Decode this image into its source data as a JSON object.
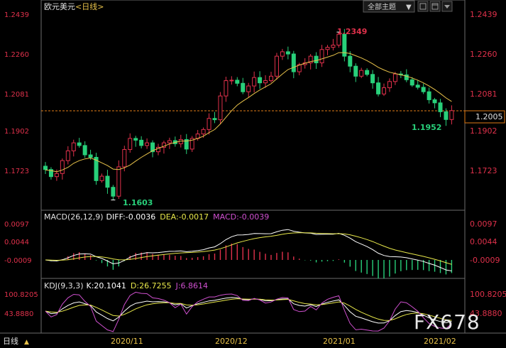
{
  "toolbar": {
    "instrument": "欧元美元",
    "period": "日线",
    "theme_label": "全部主题",
    "theme_arrow": "▼",
    "period_selector": "日线",
    "period_arrow": "▲",
    "icons": [
      "checkbox-icon",
      "window-icon",
      "scroll-down-icon"
    ]
  },
  "colors": {
    "up": "#e0314b",
    "down": "#28d07a",
    "ma": "#e8c24a",
    "diff": "#ffffff",
    "dea": "#e8e84a",
    "macd": "#d050d0",
    "k": "#ffffff",
    "d": "#e8e84a",
    "j": "#d050d0",
    "dashed": "#e07b16"
  },
  "price_axis_left": [
    "1.2439",
    "1.2260",
    "1.2081",
    "1.1902",
    "1.1723"
  ],
  "price_axis_right": [
    "1.2439",
    "1.2260",
    "1.2081",
    "1.1902",
    "1.1723"
  ],
  "current_price": "1.2005",
  "annotations": {
    "high": "1.2349",
    "low": "1.1603",
    "last_low": "1.1952"
  },
  "macd": {
    "label": "MACD(26,12,9)",
    "diff": "DIFF:-0.0036",
    "dea": "DEA:-0.0017",
    "macd": "MACD:-0.0039",
    "axis": [
      "0.0097",
      "0.0044",
      "-0.0009"
    ]
  },
  "kdj": {
    "label": "KDJ(9,3,3)",
    "k": "K:20.1041",
    "d": "D:26.7255",
    "j": "J:6.8614",
    "axis": [
      "100.8205",
      "43.8880"
    ]
  },
  "x_axis": [
    "2020/11",
    "2020/12",
    "2021/01",
    "2021/02"
  ],
  "watermark": "FX678",
  "chart_data": {
    "type": "candlestick",
    "title": "欧元美元<日线>",
    "y_range": [
      1.1603,
      1.2439
    ],
    "close": [
      1.174,
      1.1708,
      1.1722,
      1.178,
      1.1824,
      1.186,
      1.1848,
      1.1806,
      1.1795,
      1.169,
      1.171,
      1.166,
      1.162,
      1.1752,
      1.183,
      1.188,
      1.1872,
      1.1848,
      1.186,
      1.182,
      1.184,
      1.186,
      1.187,
      1.1856,
      1.1875,
      1.1832,
      1.188,
      1.19,
      1.192,
      1.197,
      1.1964,
      1.2071,
      1.214,
      1.2142,
      1.2128,
      1.209,
      1.2116,
      1.2154,
      1.213,
      1.214,
      1.216,
      1.225,
      1.227,
      1.226,
      1.218,
      1.2212,
      1.222,
      1.225,
      1.222,
      1.228,
      1.229,
      1.23,
      1.2349,
      1.225,
      1.2205,
      1.216,
      1.2186,
      1.2168,
      1.213,
      1.208,
      1.2108,
      1.2136,
      1.217,
      1.2166,
      1.2144,
      1.212,
      1.211,
      1.209,
      1.2054,
      1.204,
      1.2,
      1.1965,
      1.2005
    ],
    "ma": [
      1.1738,
      1.1735,
      1.173,
      1.1738,
      1.175,
      1.1768,
      1.178,
      1.1788,
      1.1792,
      1.1782,
      1.177,
      1.1758,
      1.1742,
      1.174,
      1.1748,
      1.176,
      1.1778,
      1.1795,
      1.181,
      1.1825,
      1.1835,
      1.1845,
      1.1855,
      1.1862,
      1.1868,
      1.1868,
      1.1872,
      1.188,
      1.189,
      1.1906,
      1.192,
      1.1945,
      1.1975,
      1.2005,
      1.203,
      1.2048,
      1.2064,
      1.2082,
      1.2098,
      1.2112,
      1.2126,
      1.2148,
      1.217,
      1.219,
      1.22,
      1.221,
      1.2218,
      1.2226,
      1.223,
      1.2238,
      1.2246,
      1.2254,
      1.2266,
      1.2266,
      1.2262,
      1.2252,
      1.2242,
      1.223,
      1.2216,
      1.22,
      1.2188,
      1.2178,
      1.2172,
      1.2166,
      1.216,
      1.2152,
      1.2142,
      1.213,
      1.2116,
      1.21,
      1.2082,
      1.2062,
      1.2046
    ]
  }
}
